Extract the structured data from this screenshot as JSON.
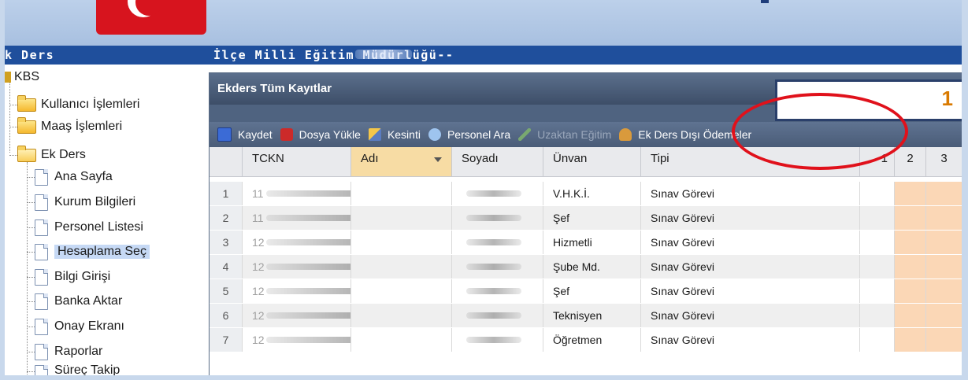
{
  "window": {
    "left_title": "k Ders",
    "center_title": "İlçe Milli Eğitim Müdürlüğü--"
  },
  "sidebar": {
    "root": "KBS",
    "items": [
      {
        "label": "Kullanıcı İşlemleri"
      },
      {
        "label": "Maaş İşlemleri"
      },
      {
        "label": "Ek Ders"
      },
      {
        "label": "Ana Sayfa"
      },
      {
        "label": "Kurum Bilgileri"
      },
      {
        "label": "Personel Listesi"
      },
      {
        "label": "Hesaplama Seç"
      },
      {
        "label": "Bilgi Girişi"
      },
      {
        "label": "Banka Aktar"
      },
      {
        "label": "Onay Ekranı"
      },
      {
        "label": "Raporlar"
      },
      {
        "label": "Süreç Takip"
      }
    ]
  },
  "panel": {
    "title": "Ekders Tüm Kayıtlar"
  },
  "toolbar": {
    "save": "Kaydet",
    "upload": "Dosya Yükle",
    "deduction": "Kesinti",
    "search_staff": "Personel Ara",
    "remote": "Uzaktan Eğitim",
    "other_payments": "Ek Ders Dışı Ödemeler"
  },
  "grid": {
    "columns": {
      "tckn": "TCKN",
      "name": "Adı",
      "surname": "Soyadı",
      "title": "Ünvan",
      "type": "Tipi",
      "c1": "1",
      "c2": "2",
      "c3": "3"
    },
    "rows": [
      {
        "n": "1",
        "tckn": "11",
        "title": "V.H.K.İ.",
        "type": "Sınav Görevi"
      },
      {
        "n": "2",
        "tckn": "11",
        "title": "Şef",
        "type": "Sınav Görevi"
      },
      {
        "n": "3",
        "tckn": "12",
        "title": "Hizmetli",
        "type": "Sınav Görevi"
      },
      {
        "n": "4",
        "tckn": "12",
        "title": "Şube Md.",
        "type": "Sınav Görevi"
      },
      {
        "n": "5",
        "tckn": "12",
        "title": "Şef",
        "type": "Sınav Görevi"
      },
      {
        "n": "6",
        "tckn": "12",
        "title": "Teknisyen",
        "type": "Sınav Görevi"
      },
      {
        "n": "7",
        "tckn": "12",
        "title": "Öğretmen",
        "type": "Sınav Görevi"
      }
    ]
  },
  "callout": {
    "number": "1",
    "color": "#e0111b"
  }
}
